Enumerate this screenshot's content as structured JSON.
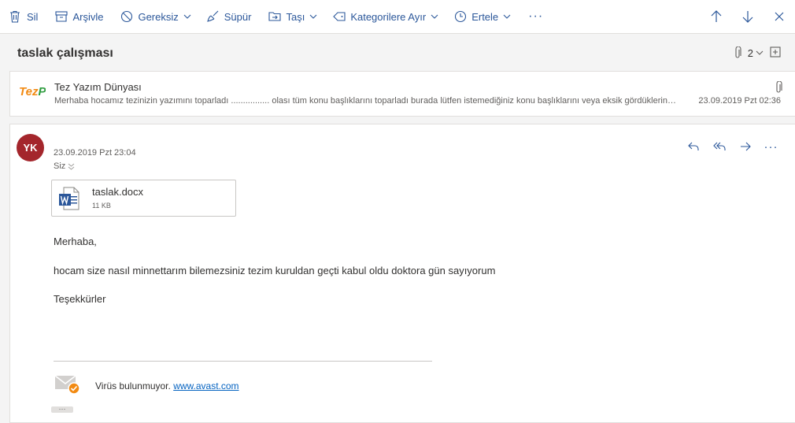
{
  "toolbar": {
    "delete_label": "Sil",
    "archive_label": "Arşivle",
    "junk_label": "Gereksiz",
    "sweep_label": "Süpür",
    "move_label": "Taşı",
    "categorize_label": "Kategorilere Ayır",
    "snooze_label": "Ertele",
    "more_label": "···"
  },
  "conversation": {
    "subject": "taslak çalışması",
    "attachment_count": "2"
  },
  "message1": {
    "logo_text_1": "Tez",
    "logo_text_2": "Pro",
    "sender": "Tez Yazım Dünyası",
    "preview": "Merhaba hocamız tezinizin yazımını toparladı ................ olası tüm konu başlıklarını toparladı burada lütfen istemediğiniz konu başlıklarını veya eksik gördükleriniz e...",
    "date": "23.09.2019 Pzt 02:36"
  },
  "message2": {
    "avatar_initials": "YK",
    "date": "23.09.2019 Pzt 23:04",
    "to": "Siz",
    "more_label": "···",
    "attachment": {
      "name": "taslak.docx",
      "size": "11 KB"
    },
    "body": {
      "greeting": "Merhaba,",
      "line1": "hocam size nasıl minnettarım bilemezsiniz tezim kuruldan geçti kabul oldu doktora gün sayıyorum",
      "closing": "Teşekkürler"
    },
    "signature": {
      "text": "Virüs bulunmuyor.",
      "link": "www.avast.com"
    },
    "expand_label": "···"
  },
  "colors": {
    "accent": "#2b579a",
    "avatar": "#a4262c",
    "link": "#0563c1"
  }
}
